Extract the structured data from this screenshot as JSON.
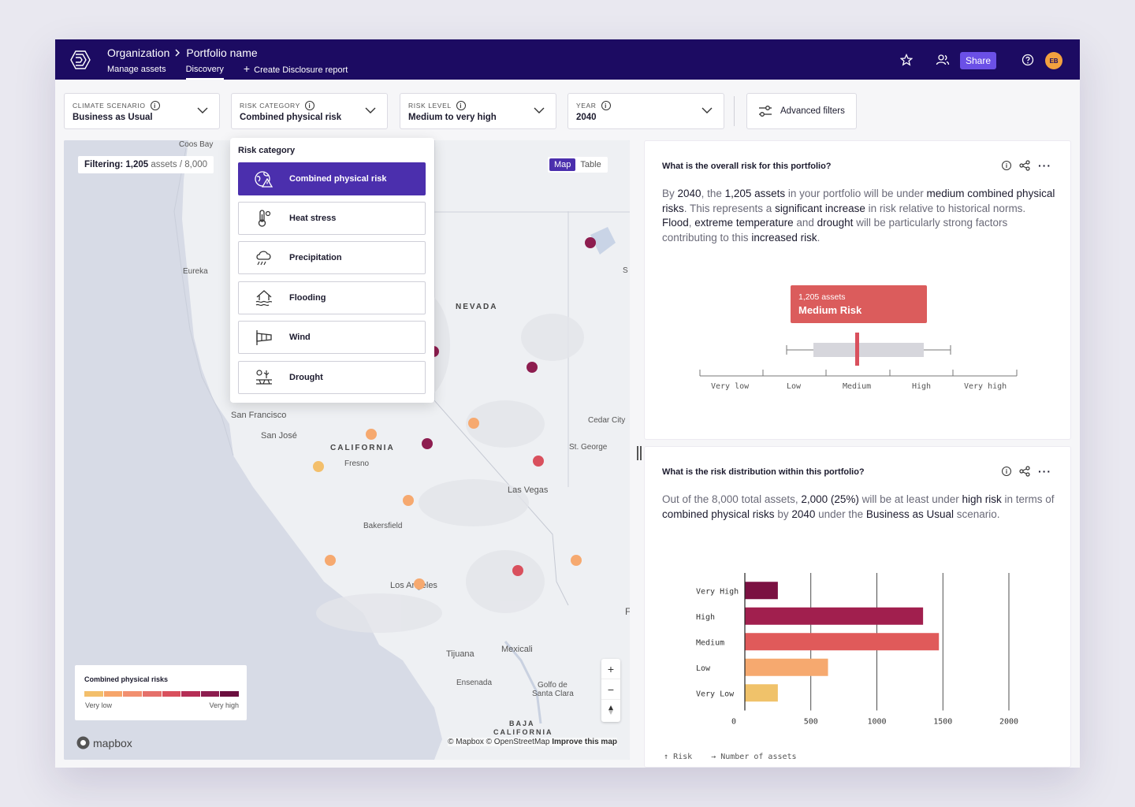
{
  "topbar": {
    "org": "Organization",
    "portfolio": "Portfolio name",
    "nav": [
      "Manage assets",
      "Discovery",
      "Create Disclosure report"
    ],
    "share": "Share",
    "avatar": "EB"
  },
  "filters": {
    "climate_label": "CLIMATE SCENARIO",
    "climate_value": "Business as Usual",
    "category_label": "RISK CATEGORY",
    "category_value": "Combined physical risk",
    "level_label": "RISK LEVEL",
    "level_value": "Medium to very high",
    "year_label": "YEAR",
    "year_value": "2040",
    "advanced": "Advanced filters"
  },
  "map": {
    "filtering_label": "Filtering:",
    "filtering_count": "1,205",
    "filtering_unit": "assets",
    "filtering_total": "/ 8,000",
    "tab_map": "Map",
    "tab_table": "Table",
    "places": [
      "Coos Bay",
      "Eureka",
      "NEVADA",
      "San Francisco",
      "San José",
      "CALIFORNIA",
      "Fresno",
      "Cedar City",
      "St. George",
      "Las Vegas",
      "Bakersfield",
      "Los Angeles",
      "Tijuana",
      "Mexicali",
      "Ensenada",
      "Golfo de",
      "Santa Clara",
      "BAJA",
      "CALIFORNIA",
      "S",
      "F"
    ],
    "legend_title": "Combined physical risks",
    "legend_low": "Very low",
    "legend_high": "Very high",
    "legend_colors": [
      "#f3bf6b",
      "#f6a56a",
      "#f28f6f",
      "#e5706a",
      "#d9505d",
      "#b52e55",
      "#8d1d4f",
      "#6b0f3f"
    ],
    "mapbox": "mapbox",
    "attribution": "© Mapbox © OpenStreetMap",
    "attribution_link": "Improve this map",
    "zoom_in": "+",
    "zoom_out": "−"
  },
  "dropdown": {
    "title": "Risk category",
    "options": [
      "Combined physical risk",
      "Heat stress",
      "Precipitation",
      "Flooding",
      "Wind",
      "Drought"
    ]
  },
  "card1": {
    "question": "What is the overall risk for this portfolio?",
    "tooltip_assets": "1,205 assets",
    "tooltip_risk": "Medium Risk",
    "scale": [
      "Very low",
      "Low",
      "Medium",
      "High",
      "Very high"
    ]
  },
  "card2": {
    "question": "What is the risk distribution within this portfolio?",
    "axis_risk": "Risk",
    "axis_assets": "Number of assets"
  },
  "chart_data": {
    "type": "bar",
    "orientation": "horizontal",
    "categories": [
      "Very High",
      "High",
      "Medium",
      "Low",
      "Very Low"
    ],
    "values": [
      250,
      1350,
      1470,
      630,
      250
    ],
    "colors": [
      "#7b1142",
      "#a11f4e",
      "#e05a5a",
      "#f6a96f",
      "#f0c26a"
    ],
    "xticks": [
      0,
      500,
      1000,
      1500,
      2000
    ],
    "xlim": [
      0,
      2000
    ],
    "xlabel": "Number of assets",
    "ylabel": "Risk"
  }
}
